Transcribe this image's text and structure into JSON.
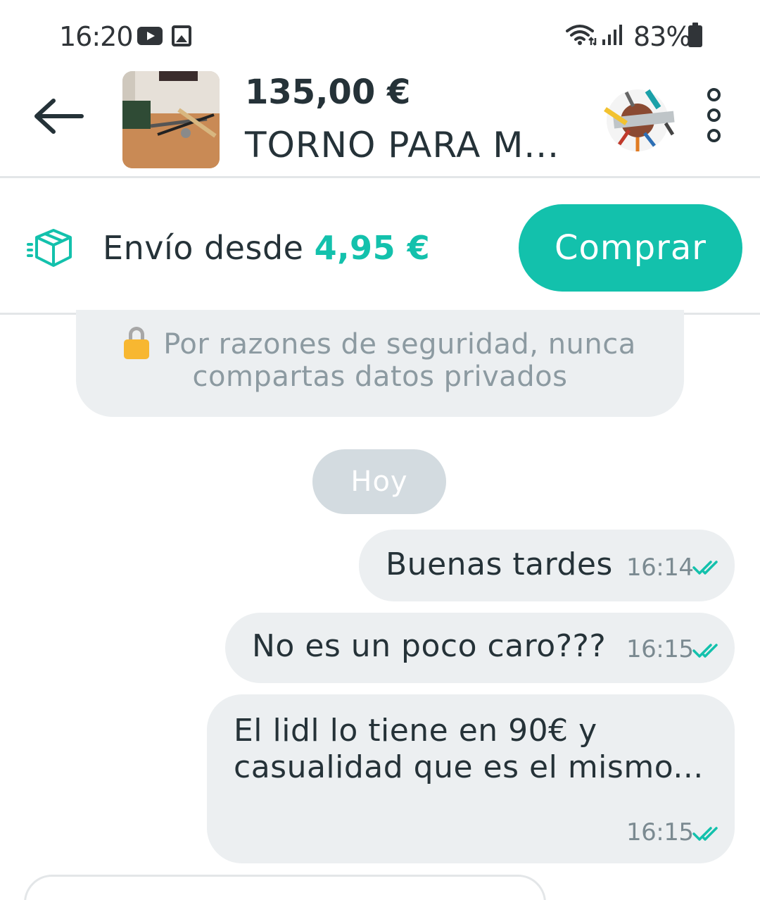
{
  "status_bar": {
    "time": "16:20",
    "battery": "83%",
    "icons": [
      "youtube-icon",
      "gallery-icon",
      "wifi-icon",
      "signal-icon",
      "battery-icon"
    ]
  },
  "header": {
    "back_icon": "arrow-left-icon",
    "price": "135,00 €",
    "title": "TORNO PARA M...",
    "menu_icon": "more-vertical-icon"
  },
  "shipping": {
    "label": "Envío desde",
    "price": "4,95 €",
    "icon": "box-icon",
    "buy_label": "Comprar"
  },
  "colors": {
    "accent": "#13c1ac",
    "text": "#253238",
    "bubble": "#eceff1",
    "muted": "#8c9aa1"
  },
  "chat": {
    "security_line1": "Por razones de seguridad, nunca",
    "security_line2": "compartas datos privados",
    "date_separator": "Hoy",
    "messages": [
      {
        "line1": "Buenas tardes",
        "line2": "",
        "time": "16:14",
        "status_icon": "double-check-icon"
      },
      {
        "line1": "No es un poco caro???",
        "line2": "",
        "time": "16:15",
        "status_icon": "double-check-icon"
      },
      {
        "line1": "El lidl lo tiene en 90€ y",
        "line2": "casualidad que es el mismo...",
        "time": "16:15",
        "status_icon": "double-check-icon"
      }
    ]
  }
}
